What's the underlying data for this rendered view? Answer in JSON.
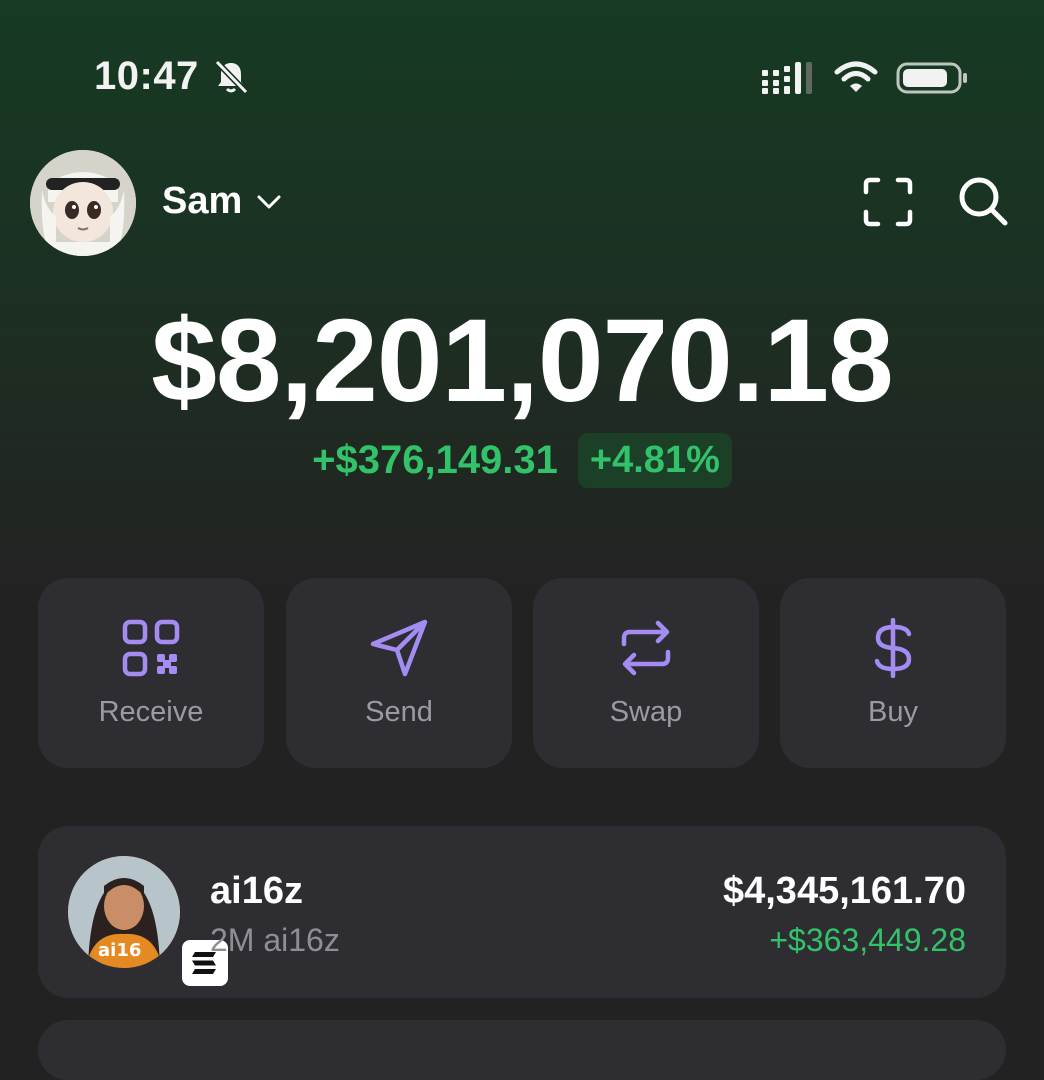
{
  "status_bar": {
    "time": "10:47",
    "icons": [
      "bell-slash-icon",
      "cellular-signal-icon",
      "wifi-icon",
      "battery-icon"
    ]
  },
  "header": {
    "account_name": "Sam",
    "icons": [
      "avatar",
      "chevron-down-icon",
      "scan-icon",
      "search-icon"
    ]
  },
  "portfolio": {
    "balance": "$8,201,070.18",
    "change_value": "+$376,149.31",
    "change_percent": "+4.81%"
  },
  "actions": [
    {
      "label": "Receive",
      "icon": "qr-code-icon"
    },
    {
      "label": "Send",
      "icon": "paper-plane-icon"
    },
    {
      "label": "Swap",
      "icon": "swap-arrows-icon"
    },
    {
      "label": "Buy",
      "icon": "dollar-icon"
    }
  ],
  "tokens": [
    {
      "name": "ai16z",
      "amount": "2M ai16z",
      "value": "$4,345,161.70",
      "change": "+$363,449.28",
      "avatar_text": "ai16",
      "chain_icon": "solana-icon"
    }
  ],
  "colors": {
    "positive": "#32c26a",
    "accent": "#a48cf2",
    "card": "#2e2e32",
    "background": "#222222"
  }
}
